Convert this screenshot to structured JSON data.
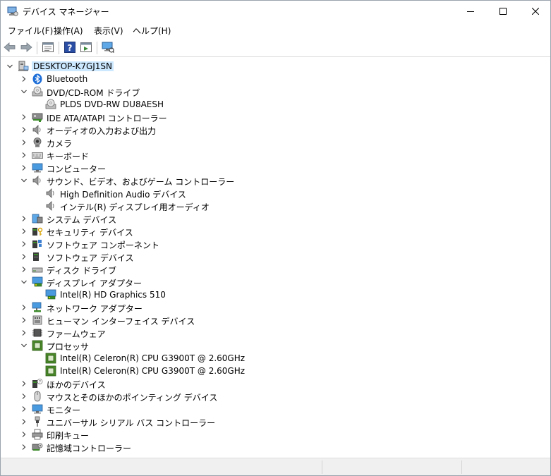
{
  "window": {
    "title": "デバイス マネージャー",
    "icons": {
      "app": "device-manager-icon",
      "minimize": "minimize-icon",
      "maximize": "maximize-icon",
      "close": "close-icon"
    }
  },
  "menu": [
    {
      "label": "ファイル(F)"
    },
    {
      "label": "操作(A)"
    },
    {
      "label": "表示(V)"
    },
    {
      "label": "ヘルプ(H)"
    }
  ],
  "toolbar": {
    "buttons": [
      "back-icon",
      "forward-icon",
      "properties-icon",
      "help-icon",
      "run-icon",
      "monitor-scan-icon"
    ]
  },
  "tree": {
    "root": "DESKTOP-K7GJ1SN",
    "items": [
      {
        "label": "Bluetooth",
        "icon": "bluetooth-icon",
        "level": 1,
        "state": "collapsed"
      },
      {
        "label": "DVD/CD-ROM ドライブ",
        "icon": "dvd-icon",
        "level": 1,
        "state": "expanded"
      },
      {
        "label": "PLDS DVD-RW DU8AESH",
        "icon": "dvd-icon",
        "level": 2,
        "state": "none"
      },
      {
        "label": "IDE ATA/ATAPI コントローラー",
        "icon": "ide-controller-icon",
        "level": 1,
        "state": "collapsed"
      },
      {
        "label": "オーディオの入力および出力",
        "icon": "speaker-icon",
        "level": 1,
        "state": "collapsed"
      },
      {
        "label": "カメラ",
        "icon": "camera-icon",
        "level": 1,
        "state": "collapsed"
      },
      {
        "label": "キーボード",
        "icon": "keyboard-icon",
        "level": 1,
        "state": "collapsed"
      },
      {
        "label": "コンピューター",
        "icon": "computer-icon",
        "level": 1,
        "state": "collapsed"
      },
      {
        "label": "サウンド、ビデオ、およびゲーム コントローラー",
        "icon": "speaker-icon",
        "level": 1,
        "state": "expanded"
      },
      {
        "label": "High Definition Audio デバイス",
        "icon": "speaker-icon",
        "level": 2,
        "state": "none"
      },
      {
        "label": "インテル(R) ディスプレイ用オーディオ",
        "icon": "speaker-icon",
        "level": 2,
        "state": "none"
      },
      {
        "label": "システム デバイス",
        "icon": "system-device-icon",
        "level": 1,
        "state": "collapsed"
      },
      {
        "label": "セキュリティ デバイス",
        "icon": "security-device-icon",
        "level": 1,
        "state": "collapsed"
      },
      {
        "label": "ソフトウェア コンポーネント",
        "icon": "software-component-icon",
        "level": 1,
        "state": "collapsed"
      },
      {
        "label": "ソフトウェア デバイス",
        "icon": "software-device-icon",
        "level": 1,
        "state": "collapsed"
      },
      {
        "label": "ディスク ドライブ",
        "icon": "disk-drive-icon",
        "level": 1,
        "state": "collapsed"
      },
      {
        "label": "ディスプレイ アダプター",
        "icon": "display-adapter-icon",
        "level": 1,
        "state": "expanded"
      },
      {
        "label": "Intel(R) HD Graphics 510",
        "icon": "display-adapter-icon",
        "level": 2,
        "state": "none"
      },
      {
        "label": "ネットワーク アダプター",
        "icon": "network-adapter-icon",
        "level": 1,
        "state": "collapsed"
      },
      {
        "label": "ヒューマン インターフェイス デバイス",
        "icon": "hid-icon",
        "level": 1,
        "state": "collapsed"
      },
      {
        "label": "ファームウェア",
        "icon": "firmware-icon",
        "level": 1,
        "state": "collapsed"
      },
      {
        "label": "プロセッサ",
        "icon": "processor-icon",
        "level": 1,
        "state": "expanded"
      },
      {
        "label": "Intel(R) Celeron(R) CPU G3900T @ 2.60GHz",
        "icon": "processor-icon",
        "level": 2,
        "state": "none"
      },
      {
        "label": "Intel(R) Celeron(R) CPU G3900T @ 2.60GHz",
        "icon": "processor-icon",
        "level": 2,
        "state": "none"
      },
      {
        "label": "ほかのデバイス",
        "icon": "other-device-icon",
        "level": 1,
        "state": "collapsed"
      },
      {
        "label": "マウスとそのほかのポインティング デバイス",
        "icon": "mouse-icon",
        "level": 1,
        "state": "collapsed"
      },
      {
        "label": "モニター",
        "icon": "monitor-icon",
        "level": 1,
        "state": "collapsed"
      },
      {
        "label": "ユニバーサル シリアル バス コントローラー",
        "icon": "usb-icon",
        "level": 1,
        "state": "collapsed"
      },
      {
        "label": "印刷キュー",
        "icon": "printer-icon",
        "level": 1,
        "state": "collapsed"
      },
      {
        "label": "記憶域コントローラー",
        "icon": "storage-controller-icon",
        "level": 1,
        "state": "collapsed"
      }
    ]
  },
  "colors": {
    "selection": "#cce8ff",
    "bluetooth": "#1e6ed8",
    "monitor": "#2d7fd3",
    "chip": "#4a8a2a"
  }
}
